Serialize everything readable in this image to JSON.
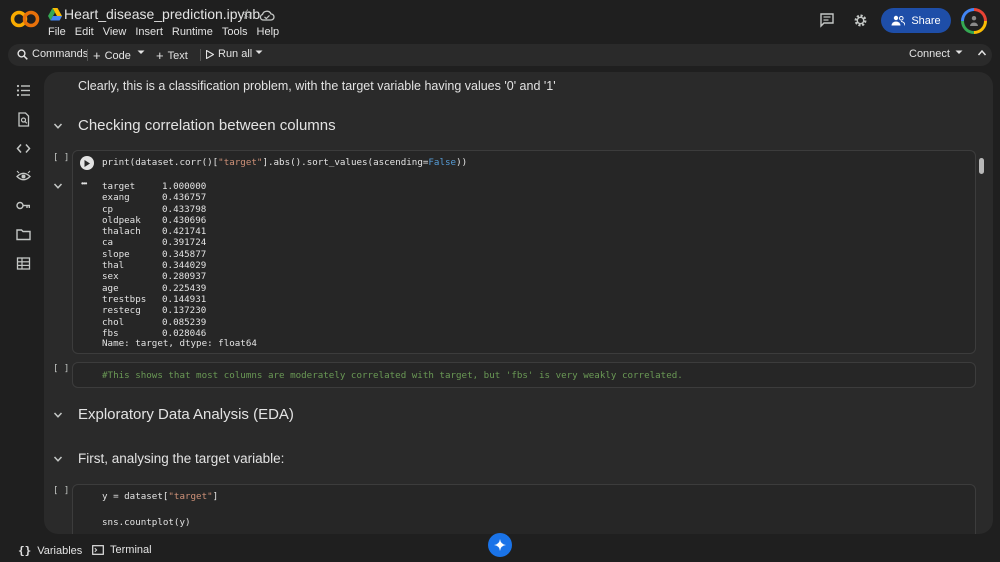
{
  "header": {
    "title": "Heart_disease_prediction.ipynb",
    "menu": [
      "File",
      "Edit",
      "View",
      "Insert",
      "Runtime",
      "Tools",
      "Help"
    ],
    "share_label": "Share"
  },
  "toolbar": {
    "commands_label": "Commands",
    "code_label": "Code",
    "text_label": "Text",
    "run_all_label": "Run all",
    "connect_label": "Connect"
  },
  "cells": {
    "md1": "Clearly, this is a classification problem, with the target variable having values '0' and '1'",
    "heading1": "Checking correlation between columns",
    "code1_bracket": "[ ]",
    "code1": {
      "p1": "print(dataset.corr()[",
      "s1": "\"target\"",
      "p2": "].abs().sort_values(ascending=",
      "k1": "False",
      "p3": "))"
    },
    "output_ellipsis": "•••",
    "output_rows": [
      [
        "target",
        "1.000000"
      ],
      [
        "exang",
        "0.436757"
      ],
      [
        "cp",
        "0.433798"
      ],
      [
        "oldpeak",
        "0.430696"
      ],
      [
        "thalach",
        "0.421741"
      ],
      [
        "ca",
        "0.391724"
      ],
      [
        "slope",
        "0.345877"
      ],
      [
        "thal",
        "0.344029"
      ],
      [
        "sex",
        "0.280937"
      ],
      [
        "age",
        "0.225439"
      ],
      [
        "trestbps",
        "0.144931"
      ],
      [
        "restecg",
        "0.137230"
      ],
      [
        "chol",
        "0.085239"
      ],
      [
        "fbs",
        "0.028046"
      ]
    ],
    "output_footer": "Name: target, dtype: float64",
    "code2_bracket": "[ ]",
    "code2_comment": "#This shows that most columns are moderately correlated with target, but 'fbs' is very weakly correlated.",
    "heading2": "Exploratory Data Analysis (EDA)",
    "heading3": "First, analysing the target variable:",
    "code3_bracket": "[ ]",
    "code3": {
      "line1_pre": "y = dataset[",
      "line1_str": "\"target\"",
      "line1_post": "]",
      "line2": "sns.countplot(y)"
    }
  },
  "statusbar": {
    "variables_label": "Variables",
    "terminal_label": "Terminal"
  },
  "colors": {
    "accent": "#1e4ea8",
    "string": "#ce9178",
    "keyword": "#569cd6",
    "comment": "#6a9955"
  }
}
